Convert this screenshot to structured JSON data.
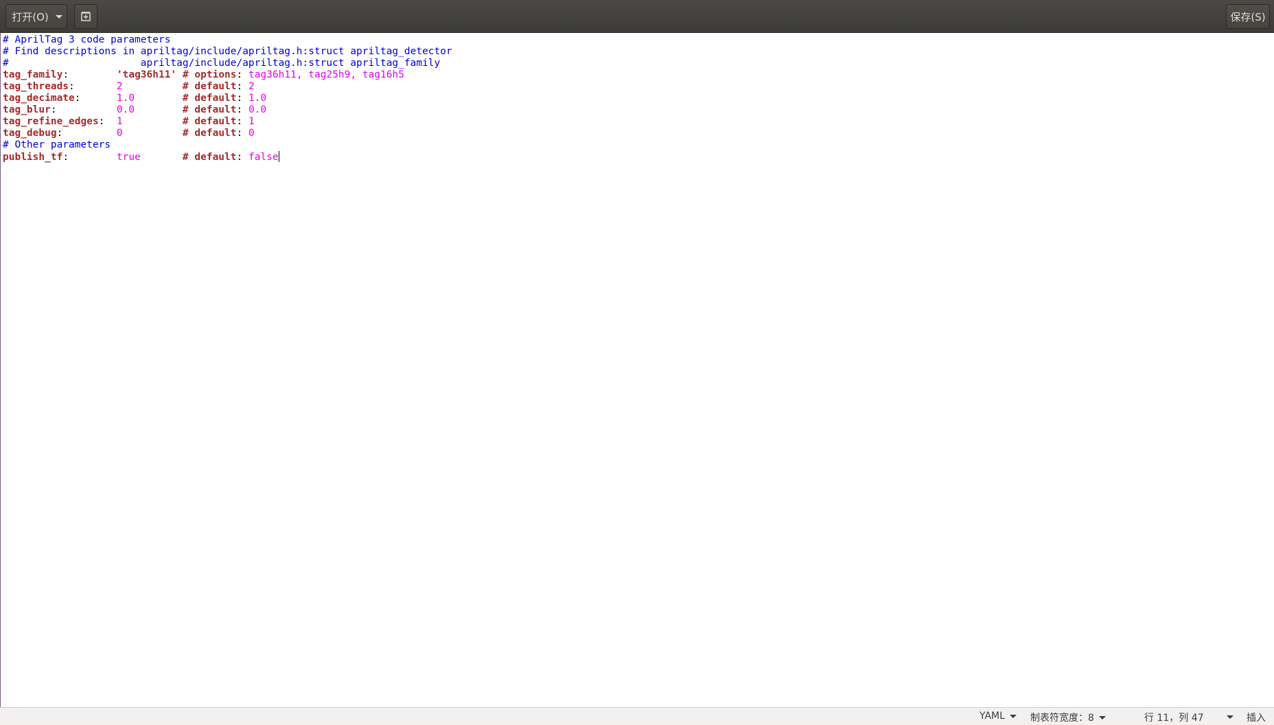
{
  "header": {
    "open_label": "打开(O)",
    "save_label": "保存(S)"
  },
  "editor": {
    "lines": [
      [
        {
          "t": "# AprilTag 3 code parameters",
          "c": "cmt"
        }
      ],
      [
        {
          "t": "# Find descriptions in apriltag/include/apriltag.h:struct apriltag_detector",
          "c": "cmt"
        }
      ],
      [
        {
          "t": "#                      apriltag/include/apriltag.h:struct apriltag_family",
          "c": "cmt"
        }
      ],
      [
        {
          "t": "tag_family",
          "c": "key"
        },
        {
          "t": ":        ",
          "c": "plain"
        },
        {
          "t": "'tag36h11'",
          "c": "str"
        },
        {
          "t": " ",
          "c": "plain"
        },
        {
          "t": "# options",
          "c": "kw"
        },
        {
          "t": ": ",
          "c": "plain"
        },
        {
          "t": "tag36h11, tag25h9, tag16h5",
          "c": "val"
        }
      ],
      [
        {
          "t": "tag_threads",
          "c": "key"
        },
        {
          "t": ":       ",
          "c": "plain"
        },
        {
          "t": "2",
          "c": "val"
        },
        {
          "t": "          ",
          "c": "plain"
        },
        {
          "t": "# default",
          "c": "kw"
        },
        {
          "t": ": ",
          "c": "plain"
        },
        {
          "t": "2",
          "c": "val"
        }
      ],
      [
        {
          "t": "tag_decimate",
          "c": "key"
        },
        {
          "t": ":      ",
          "c": "plain"
        },
        {
          "t": "1.0",
          "c": "val"
        },
        {
          "t": "        ",
          "c": "plain"
        },
        {
          "t": "# default",
          "c": "kw"
        },
        {
          "t": ": ",
          "c": "plain"
        },
        {
          "t": "1.0",
          "c": "val"
        }
      ],
      [
        {
          "t": "tag_blur",
          "c": "key"
        },
        {
          "t": ":          ",
          "c": "plain"
        },
        {
          "t": "0.0",
          "c": "val"
        },
        {
          "t": "        ",
          "c": "plain"
        },
        {
          "t": "# default",
          "c": "kw"
        },
        {
          "t": ": ",
          "c": "plain"
        },
        {
          "t": "0.0",
          "c": "val"
        }
      ],
      [
        {
          "t": "tag_refine_edges",
          "c": "key"
        },
        {
          "t": ":  ",
          "c": "plain"
        },
        {
          "t": "1",
          "c": "val"
        },
        {
          "t": "          ",
          "c": "plain"
        },
        {
          "t": "# default",
          "c": "kw"
        },
        {
          "t": ": ",
          "c": "plain"
        },
        {
          "t": "1",
          "c": "val"
        }
      ],
      [
        {
          "t": "tag_debug",
          "c": "key"
        },
        {
          "t": ":         ",
          "c": "plain"
        },
        {
          "t": "0",
          "c": "val"
        },
        {
          "t": "          ",
          "c": "plain"
        },
        {
          "t": "# default",
          "c": "kw"
        },
        {
          "t": ": ",
          "c": "plain"
        },
        {
          "t": "0",
          "c": "val"
        }
      ],
      [
        {
          "t": "# Other parameters",
          "c": "cmt"
        }
      ],
      [
        {
          "t": "publish_tf",
          "c": "key"
        },
        {
          "t": ":        ",
          "c": "plain"
        },
        {
          "t": "true",
          "c": "val"
        },
        {
          "t": "       ",
          "c": "plain"
        },
        {
          "t": "# default",
          "c": "kw"
        },
        {
          "t": ": ",
          "c": "plain"
        },
        {
          "t": "false",
          "c": "val"
        }
      ]
    ],
    "cursor_line": 11,
    "colors": {
      "comment": "#0000d6",
      "key": "#a52a2a",
      "value": "#e600e6"
    }
  },
  "statusbar": {
    "language": "YAML",
    "tab_width": "制表符宽度：8",
    "position": "行 11，列 47",
    "mode": "插入"
  }
}
